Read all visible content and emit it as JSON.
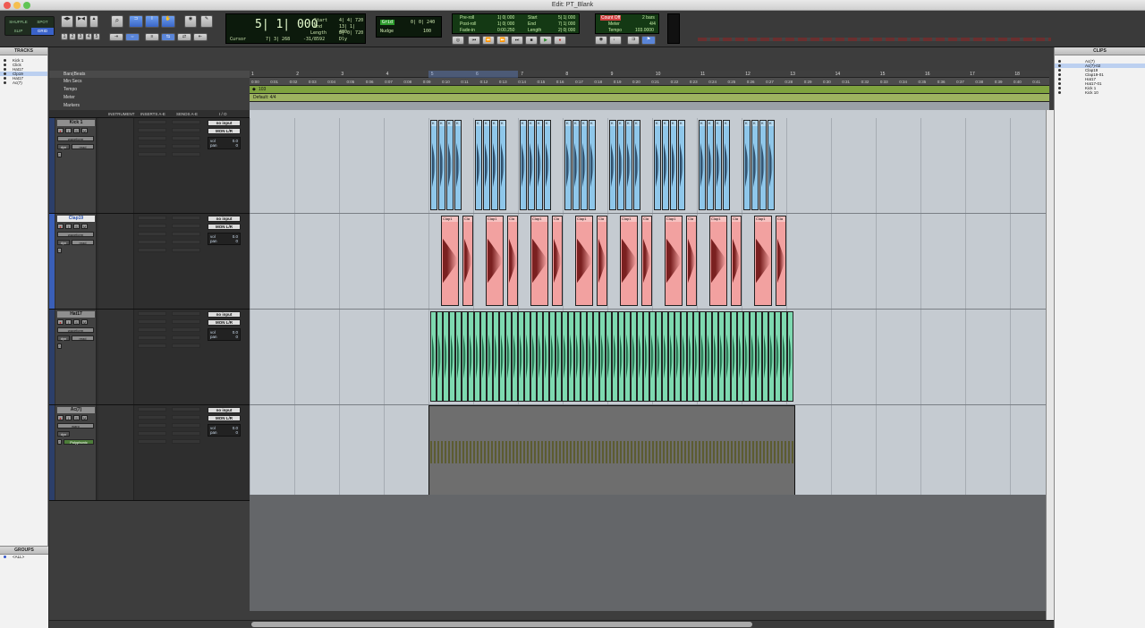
{
  "window": {
    "title": "Edit: PT_Blank"
  },
  "toolbar": {
    "edit_modes": [
      "SHUFFLE",
      "SPOT",
      "SLIP",
      "GRID"
    ],
    "zoom_presets": [
      "1",
      "2",
      "3",
      "4",
      "5"
    ],
    "main_counter": "5| 1| 000",
    "sub_counter": "7| 3| 268",
    "cursor_label": "Cursor",
    "cursor_value": "-31/8592",
    "dly_label": "Dly",
    "selection": {
      "start_label": "Start",
      "start_value": "4| 4| 720",
      "end_label": "End",
      "end_value": "13| 1| 480",
      "length_label": "Length",
      "length_value": "8| 0| 720"
    },
    "grid": {
      "label": "Grid",
      "value": "0| 0| 240"
    },
    "nudge": {
      "label": "Nudge",
      "value": "100"
    },
    "preroll": {
      "preroll_label": "Pre-roll",
      "preroll_value": "1| 0| 000",
      "postroll_label": "Post-roll",
      "postroll_value": "1| 0| 000",
      "fadein_label": "Fade-in",
      "fadein_value": "0:00.250",
      "start_label": "Start",
      "start_value": "5| 1| 000",
      "end_label": "End",
      "end_value": "7| 1| 000",
      "length_label": "Length",
      "length_value": "2| 0| 000"
    },
    "count": {
      "count_label": "Count Off",
      "count_value": "2 bars",
      "meter_label": "Meter",
      "meter_value": "4/4",
      "tempo_label": "Tempo",
      "tempo_value": "103.0000"
    }
  },
  "tracks_panel": {
    "header": "TRACKS",
    "items": [
      {
        "name": "Kick 1",
        "selected": false
      },
      {
        "name": "Click",
        "selected": false
      },
      {
        "name": "Hat17",
        "selected": false
      },
      {
        "name": "Clp19",
        "selected": true
      },
      {
        "name": "Hat17",
        "selected": false
      },
      {
        "name": "Ac(7)",
        "selected": false
      }
    ]
  },
  "groups_panel": {
    "header": "GROUPS",
    "all_label": "<ALL>"
  },
  "clips_panel": {
    "header": "CLIPS",
    "items": [
      {
        "name": "Ac(7)",
        "selected": false
      },
      {
        "name": "Ac(7)-02",
        "selected": true
      },
      {
        "name": "Clap19",
        "selected": false
      },
      {
        "name": "Clap19-01",
        "selected": false
      },
      {
        "name": "Hat17",
        "selected": false
      },
      {
        "name": "Hat17-01",
        "selected": false
      },
      {
        "name": "Kick 1",
        "selected": false
      },
      {
        "name": "Kick 10",
        "selected": false
      }
    ]
  },
  "rulers": {
    "labels": [
      "Bars|Beats",
      "Min:Secs",
      "Tempo",
      "Meter",
      "Markers"
    ],
    "bars": [
      "1",
      "2",
      "3",
      "4",
      "5",
      "6",
      "7",
      "8",
      "9",
      "10",
      "11",
      "12",
      "13",
      "14",
      "15",
      "16",
      "17",
      "18"
    ],
    "mins": [
      "0:00",
      "0:01",
      "0:02",
      "0:03",
      "0:04",
      "0:05",
      "0:06",
      "0:07",
      "0:08",
      "0:09",
      "0:10",
      "0:11",
      "0:12",
      "0:13",
      "0:14",
      "0:15",
      "0:16",
      "0:17",
      "0:18",
      "0:19",
      "0:20",
      "0:21",
      "0:22",
      "0:23",
      "0:24",
      "0:25",
      "0:26",
      "0:27",
      "0:28",
      "0:29",
      "0:30",
      "0:31",
      "0:32",
      "0:33",
      "0:34",
      "0:35",
      "0:36",
      "0:37",
      "0:38",
      "0:39",
      "0:40",
      "0:41"
    ],
    "tempo_value": "103",
    "meter_value": "Default: 4/4"
  },
  "column_headers": {
    "instrument": "INSTRUMENT",
    "inserts": "INSERTS A-E",
    "sends": "SENDS A-E",
    "io": "I / O"
  },
  "track_headers": [
    {
      "name": "Kick 1",
      "view": "waveform",
      "dyn": "dyn",
      "mode": "read",
      "input": "no input",
      "output": "MON L/R",
      "vol": "0.0",
      "pan": "0",
      "selected": false
    },
    {
      "name": "Clap19",
      "view": "waveform",
      "dyn": "dyn",
      "mode": "read",
      "input": "no input",
      "output": "MON L/R",
      "vol": "0.0",
      "pan": "0",
      "selected": true
    },
    {
      "name": "Hat17",
      "view": "waveform",
      "dyn": "dyn",
      "mode": "read",
      "input": "no input",
      "output": "MON L/R",
      "vol": "0.0",
      "pan": "0",
      "selected": false
    },
    {
      "name": "Ac(7)",
      "view": "warp",
      "dyn": "dyn",
      "mode": "Polyphonic",
      "input": "no input",
      "output": "MON L/R",
      "vol": "0.0",
      "pan": "0",
      "selected": false
    }
  ],
  "clip_labels": {
    "kick": "K",
    "clap": "Clap1",
    "clap_short": "Cla",
    "hat": "",
    "ac": ""
  },
  "colors": {
    "kick": "#8fc7ea",
    "clap": "#f2a1a0",
    "hat": "#7ed9b0",
    "ac": "#6e6e6e",
    "selection_blue": "#2c3f6a"
  }
}
